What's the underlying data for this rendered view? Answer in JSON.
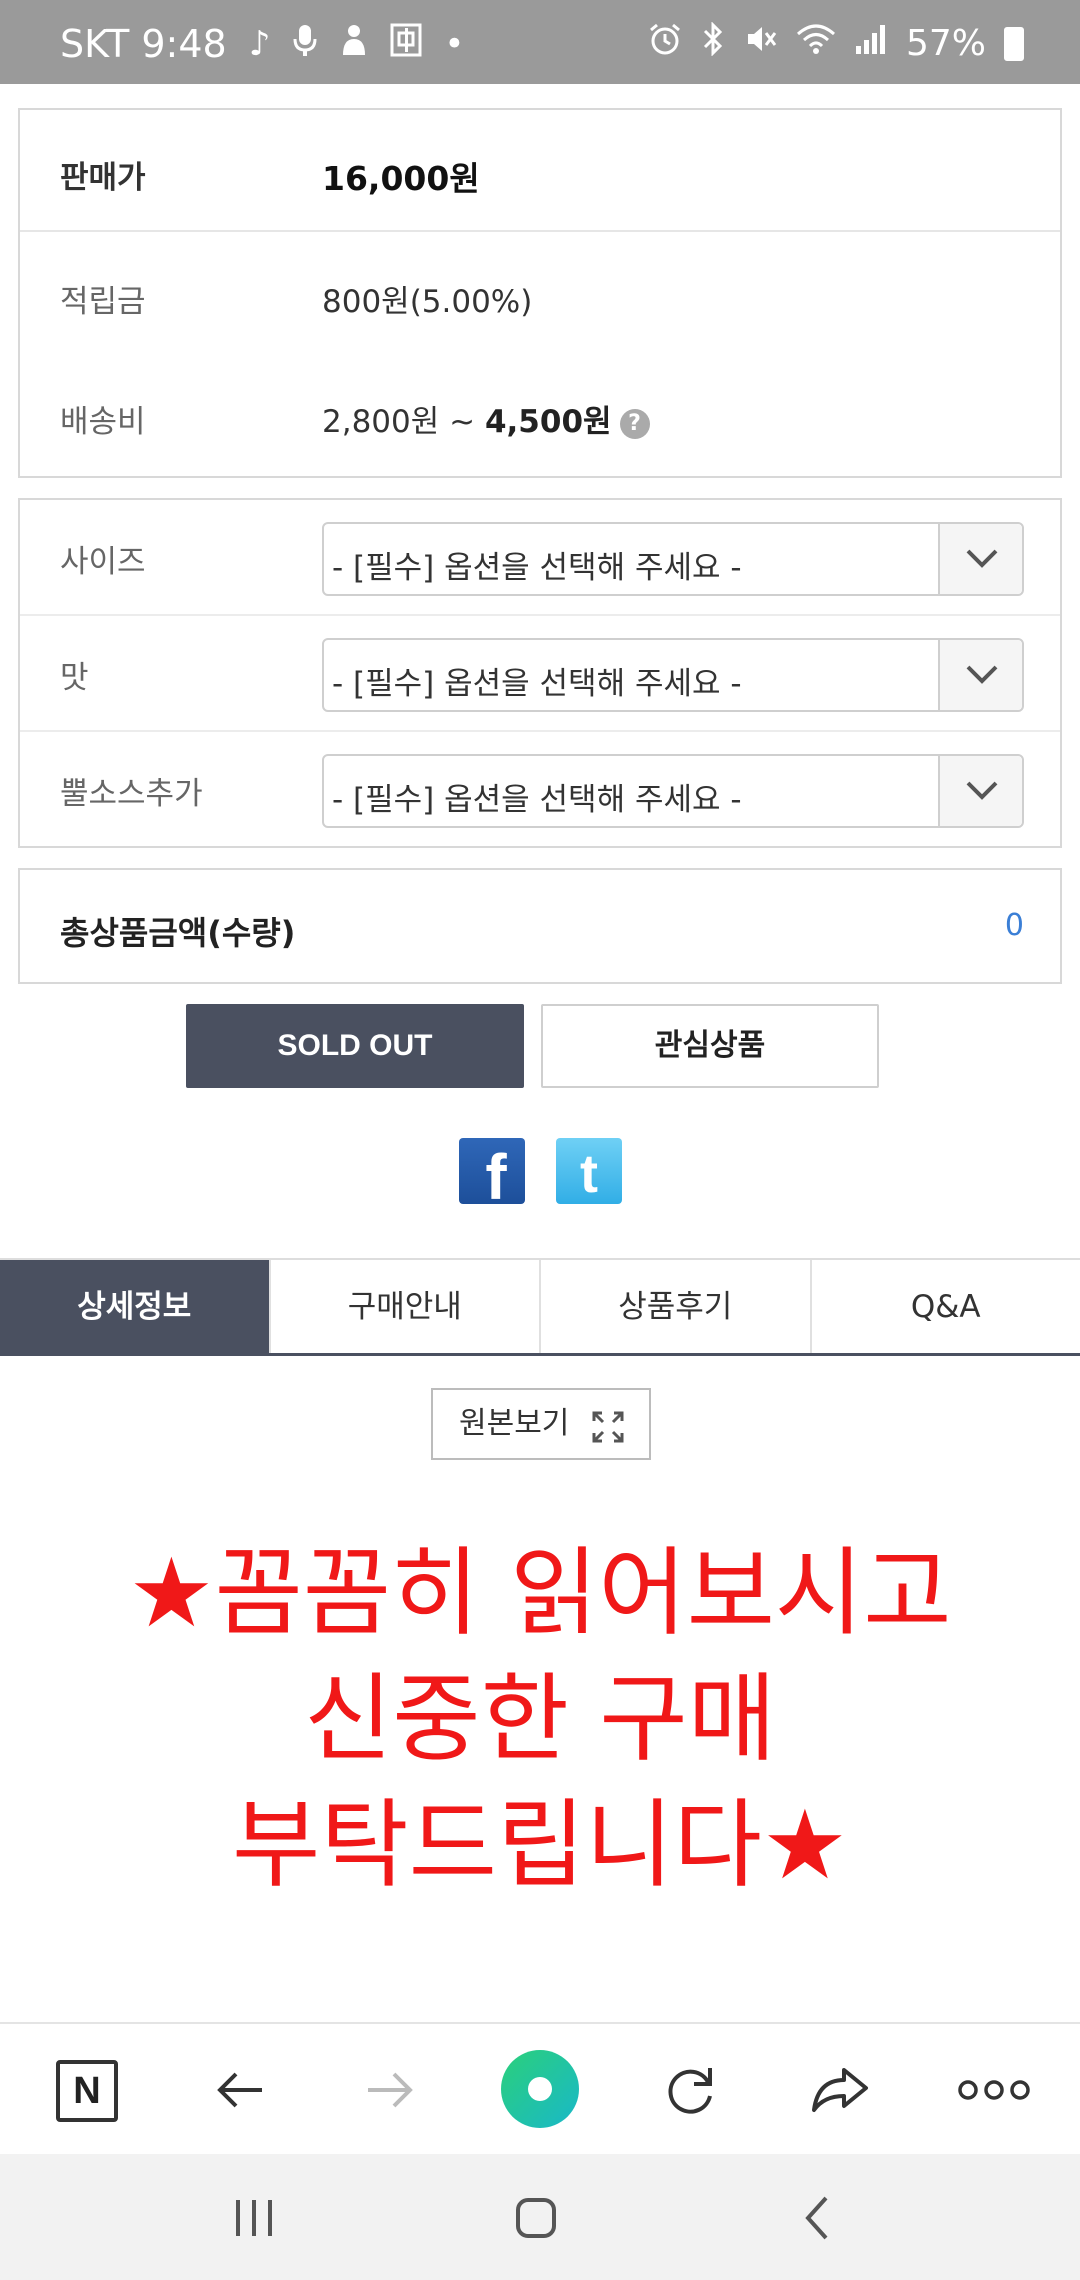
{
  "status_bar": {
    "carrier_time": "SKT 9:48",
    "battery": "57%"
  },
  "price": {
    "sale_label": "판매가",
    "sale_value": "16,000원",
    "points_label": "적립금",
    "points_value": "800원(5.00%)",
    "shipping_label": "배송비",
    "shipping_min": "2,800원 ~ ",
    "shipping_max": "4,500원",
    "help": "?"
  },
  "options": [
    {
      "label": "사이즈",
      "value": "- [필수] 옵션을 선택해 주세요 -"
    },
    {
      "label": "맛",
      "value": "- [필수] 옵션을 선택해 주세요 -"
    },
    {
      "label": "뿔소스추가",
      "value": "- [필수] 옵션을 선택해 주세요 -"
    }
  ],
  "total": {
    "label": "총상품금액(수량)",
    "value": "0"
  },
  "buttons": {
    "sold_out": "SOLD OUT",
    "wishlist": "관심상품"
  },
  "social": {
    "facebook_glyph": "f",
    "twitter_glyph": "t"
  },
  "tabs": [
    "상세정보",
    "구매안내",
    "상품후기",
    "Q&A"
  ],
  "detail": {
    "original_view": "원본보기",
    "headline_line1": "★꼼꼼히 읽어보시고",
    "headline_line2": "신중한 구매",
    "headline_line3": "부탁드립니다★"
  },
  "toolbar": {
    "home_label": "N"
  },
  "colors": {
    "dark_slate": "#4a5060",
    "accent_blue": "#3b7fd6",
    "headline_red": "#f01818"
  }
}
